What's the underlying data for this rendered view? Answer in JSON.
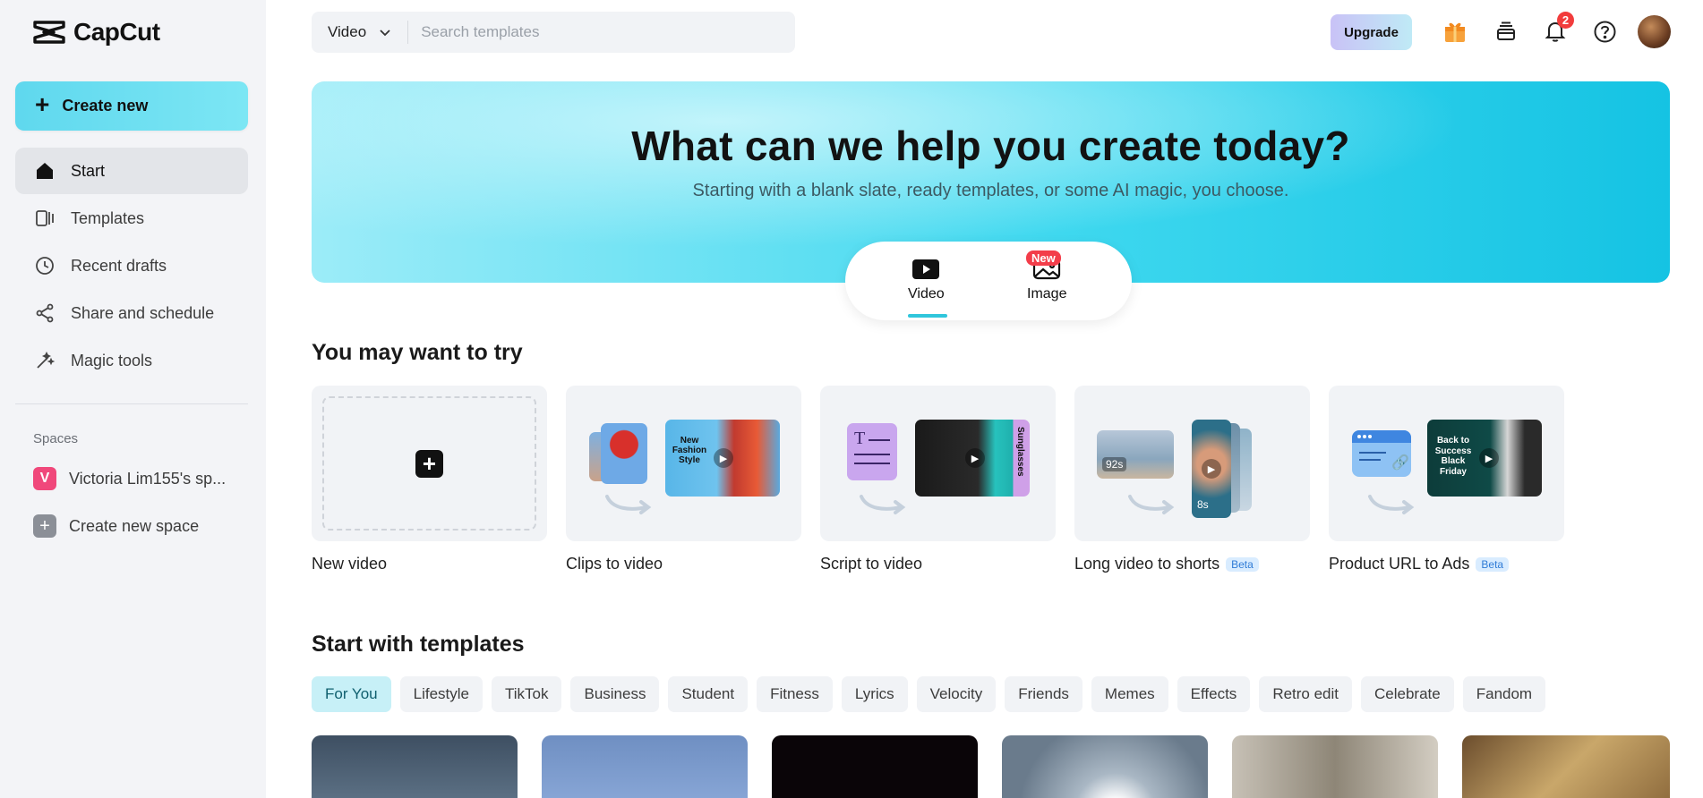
{
  "app": {
    "name": "CapCut"
  },
  "sidebar": {
    "create_label": "Create new",
    "items": [
      {
        "label": "Start",
        "icon": "home-icon"
      },
      {
        "label": "Templates",
        "icon": "templates-icon"
      },
      {
        "label": "Recent drafts",
        "icon": "clock-icon"
      },
      {
        "label": "Share and schedule",
        "icon": "share-icon"
      },
      {
        "label": "Magic tools",
        "icon": "magic-wand-icon"
      }
    ],
    "spaces_label": "Spaces",
    "spaces": [
      {
        "badge": "V",
        "label": "Victoria Lim155's sp..."
      }
    ],
    "create_space_label": "Create new space"
  },
  "topbar": {
    "search_type": "Video",
    "search_placeholder": "Search templates",
    "upgrade_label": "Upgrade",
    "notification_count": "2"
  },
  "hero": {
    "title": "What can we help you create today?",
    "subtitle": "Starting with a blank slate, ready templates, or some AI magic, you choose.",
    "modes": [
      {
        "label": "Video",
        "icon": "video-icon"
      },
      {
        "label": "Image",
        "icon": "image-icon",
        "tag": "New"
      }
    ]
  },
  "try_section": {
    "title": "You may want to try",
    "cards": [
      {
        "label": "New video"
      },
      {
        "label": "Clips to video",
        "thumb_text": "New Fashion Style"
      },
      {
        "label": "Script to video",
        "thumb_text": "Sunglasses"
      },
      {
        "label": "Long video to shorts",
        "badge": "Beta",
        "durations": [
          "92s",
          "8s"
        ]
      },
      {
        "label": "Product URL to Ads",
        "badge": "Beta",
        "thumb_text": "Back to Success Black Friday"
      }
    ]
  },
  "templates_section": {
    "title": "Start with templates",
    "chips": [
      "For You",
      "Lifestyle",
      "TikTok",
      "Business",
      "Student",
      "Fitness",
      "Lyrics",
      "Velocity",
      "Friends",
      "Memes",
      "Effects",
      "Retro edit",
      "Celebrate",
      "Fandom"
    ],
    "active_chip": "For You"
  },
  "colors": {
    "accent": "#2fc6dc",
    "create_button": "#5fd8ee",
    "sidebar_bg": "#f3f4f7",
    "notification": "#f23c3c",
    "beta_text": "#2f7bd6"
  }
}
